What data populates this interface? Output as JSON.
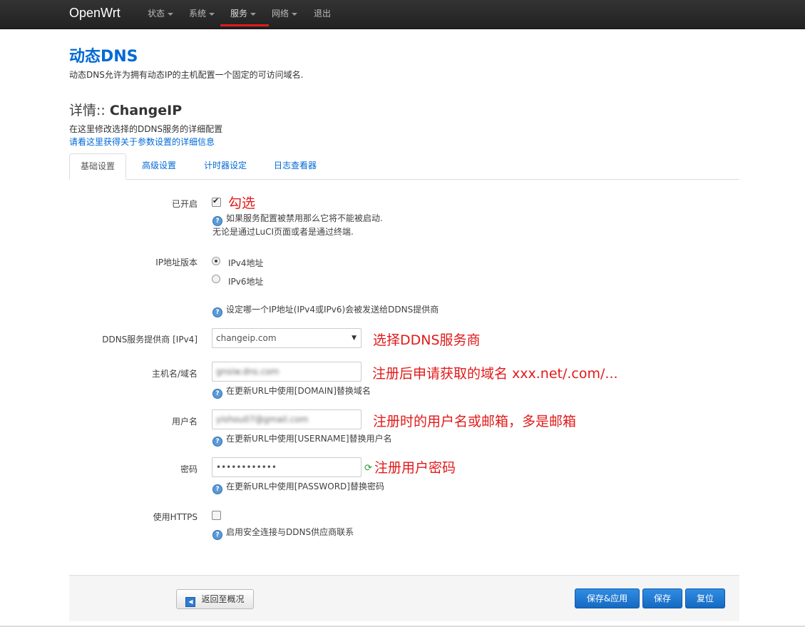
{
  "nav": {
    "brand": "OpenWrt",
    "items": [
      {
        "label": "状态"
      },
      {
        "label": "系统"
      },
      {
        "label": "服务"
      },
      {
        "label": "网络"
      },
      {
        "label": "退出"
      }
    ]
  },
  "page": {
    "title": "动态DNS",
    "description": "动态DNS允许为拥有动态IP的主机配置一个固定的可访问域名."
  },
  "section": {
    "title_prefix": "详情:: ",
    "title_name": "ChangeIP",
    "description": "在这里修改选择的DDNS服务的详细配置",
    "link": "请看这里获得关于参数设置的详细信息"
  },
  "tabs": [
    "基础设置",
    "高级设置",
    "计时器设定",
    "日志查看器"
  ],
  "form": {
    "enabled": {
      "label": "已开启",
      "checked": true,
      "help_line1": "如果服务配置被禁用那么它将不能被启动.",
      "help_line2": "无论是通过LuCI页面或者是通过终端."
    },
    "ip_version": {
      "label": "IP地址版本",
      "options": [
        "IPv4地址",
        "IPv6地址"
      ],
      "selected": "IPv4地址",
      "help": "设定哪一个IP地址(IPv4或IPv6)会被发送给DDNS提供商"
    },
    "provider": {
      "label": "DDNS服务提供商 [IPv4]",
      "value": "changeip.com"
    },
    "hostname": {
      "label": "主机名/域名",
      "value": "gnsiw.dns.com",
      "help": "在更新URL中使用[DOMAIN]替换域名"
    },
    "username": {
      "label": "用户名",
      "value": "yishou07@gmail.com",
      "help": "在更新URL中使用[USERNAME]替换用户名"
    },
    "password": {
      "label": "密码",
      "value": "••••••••••••",
      "help": "在更新URL中使用[PASSWORD]替换密码"
    },
    "https": {
      "label": "使用HTTPS",
      "checked": false,
      "help": "启用安全连接与DDNS供应商联系"
    }
  },
  "annotations": {
    "enabled": "勾选",
    "provider": "选择DDNS服务商",
    "hostname": "注册后申请获取的域名  xxx.net/.com/...",
    "username": "注册时的用户名或邮箱，多是邮箱",
    "password": "注册用户密码"
  },
  "footer": {
    "back": "返回至概况",
    "save_apply": "保存&应用",
    "save": "保存",
    "reset": "复位"
  },
  "colors": {
    "accent": "#0069d6",
    "annotation": "#e21a1a",
    "button": "#1669c0"
  }
}
